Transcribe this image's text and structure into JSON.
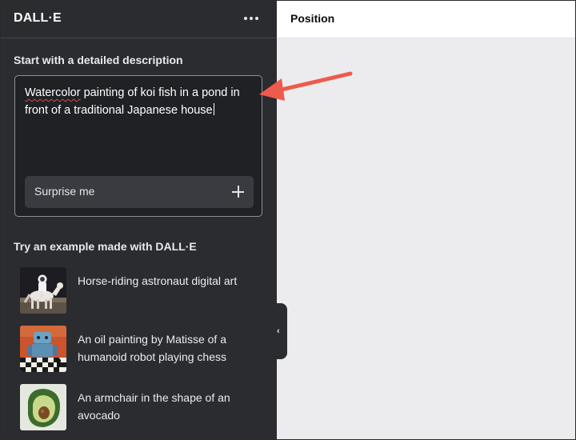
{
  "sidebar": {
    "title": "DALL·E",
    "more_icon": "more-horizontal-icon",
    "description_heading": "Start with a detailed description",
    "prompt": {
      "misspelled_word": "Watercolor",
      "rest_line1": " painting of koi fish in a pond in",
      "line2": "front of a traditional Japanese house"
    },
    "surprise_label": "Surprise me",
    "examples_heading": "Try an example made with DALL·E",
    "examples": [
      {
        "label": "Horse-riding astronaut digital art"
      },
      {
        "label": "An oil painting by Matisse of a humanoid robot playing chess"
      },
      {
        "label": "An armchair in the shape of an avocado"
      }
    ]
  },
  "main": {
    "title": "Position"
  },
  "colors": {
    "sidebar_bg": "#2b2c30",
    "prompt_bg": "#202125",
    "annotation_arrow": "#ee5a4c",
    "canvas_bg": "#ececee"
  }
}
